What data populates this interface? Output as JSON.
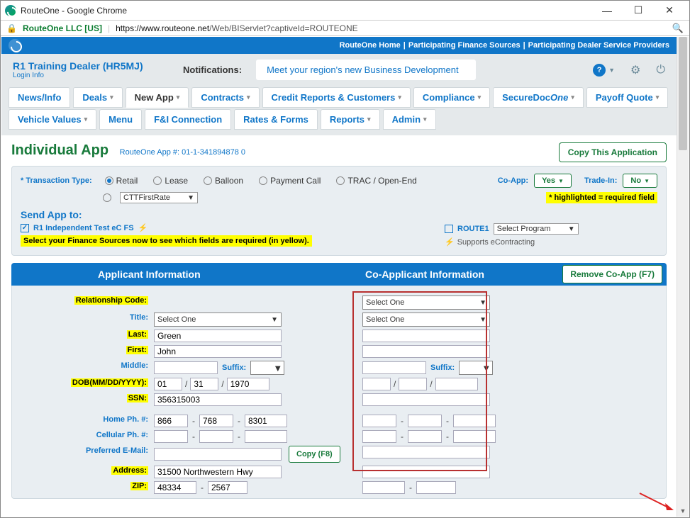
{
  "window": {
    "title": "RouteOne - Google Chrome"
  },
  "address": {
    "org": "RouteOne LLC [US]",
    "url_host": "https://www.routeone.net",
    "url_path": "/Web/BIServlet?captiveId=ROUTEONE"
  },
  "topbar": {
    "home": "RouteOne Home",
    "pfs": "Participating Finance Sources",
    "pdsp": "Participating Dealer Service Providers"
  },
  "header": {
    "dealer": "R1 Training Dealer (HR5MJ)",
    "login_info": "Login Info",
    "notif_label": "Notifications:",
    "notif_text": "Meet your region's new Business Development"
  },
  "nav": {
    "row1": [
      "News/Info",
      "Deals",
      "New App",
      "Contracts",
      "Credit Reports & Customers",
      "Compliance",
      "SecureDocOne",
      "Payoff Quote"
    ],
    "row2": [
      "Vehicle Values",
      "Menu",
      "F&I Connection",
      "Rates & Forms",
      "Reports",
      "Admin"
    ],
    "caret_tabs": [
      "Deals",
      "New App",
      "Contracts",
      "Credit Reports & Customers",
      "Compliance",
      "SecureDocOne",
      "Payoff Quote",
      "Vehicle Values",
      "Reports",
      "Admin"
    ],
    "active": "New App",
    "securedoc_html": "SecureDoc<i>One</i>"
  },
  "page": {
    "title": "Individual App",
    "app_num_label": "RouteOne App #: 01-1-341894878 0",
    "copy_btn": "Copy This Application"
  },
  "trans": {
    "label": "* Transaction Type:",
    "options": [
      "Retail",
      "Lease",
      "Balloon",
      "Payment Call",
      "TRAC / Open-End"
    ],
    "selected": "Retail",
    "program_select": "CTTFirstRate",
    "coapp_label": "Co-App:",
    "coapp_val": "Yes",
    "tradein_label": "Trade-In:",
    "tradein_val": "No",
    "req_note": "* highlighted = required field"
  },
  "send": {
    "title": "Send App to:",
    "fs1_label": "R1 Independent Test eC FS",
    "route1_label": "ROUTE1",
    "route1_select": "Select Program",
    "yellow": "Select your Finance Sources now to see which fields are required (in yellow).",
    "supports": "Supports eContracting"
  },
  "section": {
    "app": "Applicant Information",
    "coapp": "Co-Applicant Information",
    "remove": "Remove Co-App  (F7)"
  },
  "form": {
    "labels": {
      "relationship": "Relationship Code:",
      "title": "Title:",
      "last": "Last:",
      "first": "First:",
      "middle": "Middle:",
      "suffix": "Suffix:",
      "dob": "DOB(MM/DD/YYYY):",
      "ssn": "SSN:",
      "homeph": "Home Ph. #:",
      "cellph": "Cellular Ph. #:",
      "email": "Preferred E-Mail:",
      "address": "Address:",
      "zip": "ZIP:"
    },
    "app": {
      "title": "Select One",
      "last": "Green",
      "first": "John",
      "middle": "",
      "dob_mm": "01",
      "dob_dd": "31",
      "dob_yyyy": "1970",
      "ssn": "356315003",
      "home1": "866",
      "home2": "768",
      "home3": "8301",
      "cell1": "",
      "cell2": "",
      "cell3": "",
      "email": "",
      "address": "31500 Northwestern Hwy",
      "zip1": "48334",
      "zip2": "2567"
    },
    "coapp": {
      "relationship": "Select One",
      "title": "Select One"
    },
    "copy_btn": "Copy (F8)"
  }
}
